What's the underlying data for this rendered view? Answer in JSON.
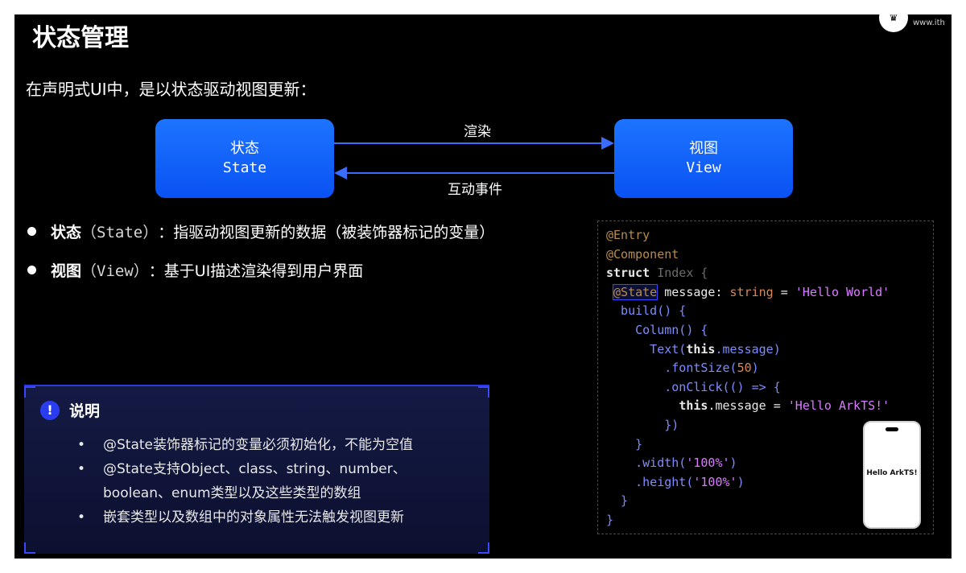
{
  "title": "状态管理",
  "logo": {
    "text": "www.ith"
  },
  "intro": "在声明式UI中，是以状态驱动视图更新：",
  "diagram": {
    "state_box": {
      "zh": "状态",
      "en": "State"
    },
    "view_box": {
      "zh": "视图",
      "en": "View"
    },
    "render_label": "渲染",
    "events_label": "互动事件"
  },
  "bullets": [
    {
      "term": "状态",
      "paren": "（State）",
      "desc": "：指驱动视图更新的数据（被装饰器标记的变量）"
    },
    {
      "term": "视图",
      "paren": "（View）",
      "desc": "：基于UI描述渲染得到用户界面"
    }
  ],
  "note": {
    "icon": "!",
    "title": "说明",
    "items": [
      "@State装饰器标记的变量必须初始化，不能为空值",
      "@State支持Object、class、string、number、",
      "boolean、enum类型以及这些类型的数组",
      "嵌套类型以及数组中的对象属性无法触发视图更新"
    ]
  },
  "code": {
    "l1": "@Entry",
    "l2": "@Component",
    "l3_kw": "struct",
    "l3_name": " Index {",
    "l4_dec": "@State",
    "l4_var": " message: ",
    "l4_type": "string",
    "l4_eq": " = ",
    "l4_str": "'Hello World'",
    "l5": "  build() {",
    "l6": "    Column() {",
    "l7_fn": "      Text(",
    "l7_this": "this",
    "l7_rest": ".message)",
    "l8_a": "        .fontSize(",
    "l8_n": "50",
    "l8_b": ")",
    "l9": "        .onClick(() => {",
    "l10_this": "this",
    "l10_a": ".message = ",
    "l10_str": "'Hello ArkTS!'",
    "l11": "        })",
    "l12": "    }",
    "l13_a": "    .width(",
    "l13_s": "'100%'",
    "l13_b": ")",
    "l14_a": "    .height(",
    "l14_s": "'100%'",
    "l14_b": ")",
    "l15": "  }",
    "l16": "}"
  },
  "phone": {
    "text": "Hello ArkTS!"
  },
  "colors": {
    "box_blue": "#0a52f3",
    "accent": "#3b46ff",
    "decorator": "#b98b4b",
    "string": "#d97cff"
  }
}
